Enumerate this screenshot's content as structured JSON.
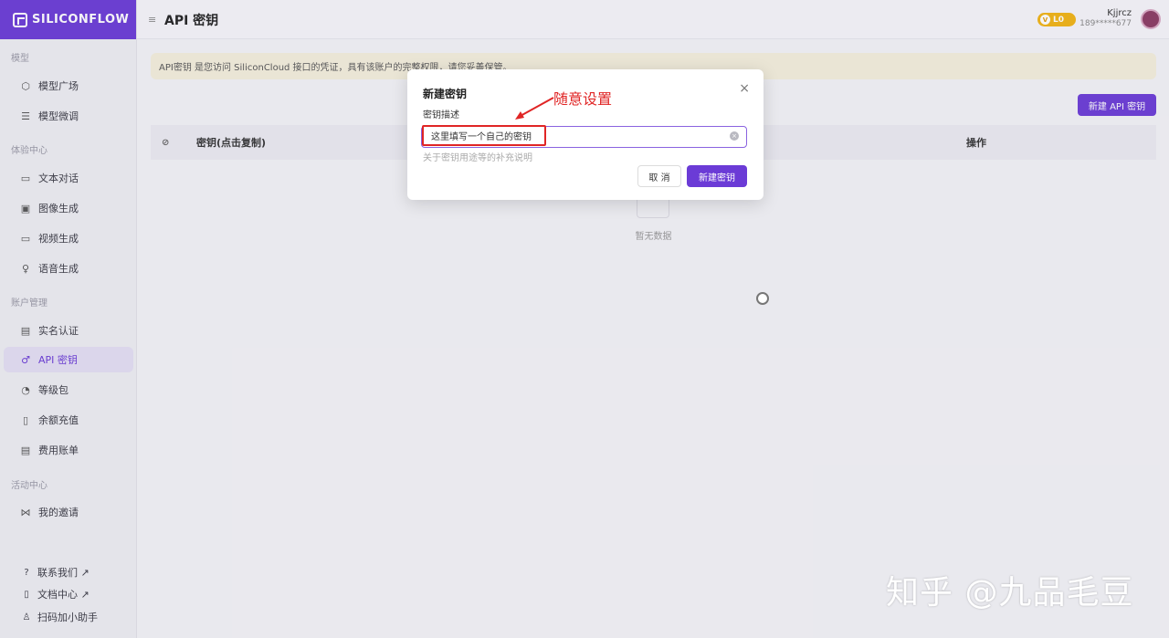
{
  "brand": {
    "logo_text": "SILICONFLOW"
  },
  "header": {
    "menu_icon": "menu-icon",
    "title": "API 密钥",
    "level": "L0",
    "level_coin": "V",
    "user_name": "Kjjrcz",
    "user_phone": "189*****677"
  },
  "sidebar": {
    "sections": [
      {
        "label": "模型"
      },
      {
        "label": "体验中心"
      },
      {
        "label": "账户管理"
      },
      {
        "label": "活动中心"
      }
    ],
    "items": [
      {
        "label": "模型广场",
        "icon": "cube-icon",
        "glyph": "⬡"
      },
      {
        "label": "模型微调",
        "icon": "sliders-icon",
        "glyph": "☰"
      },
      {
        "label": "文本对话",
        "icon": "chat-icon",
        "glyph": "▭"
      },
      {
        "label": "图像生成",
        "icon": "image-icon",
        "glyph": "▣"
      },
      {
        "label": "视频生成",
        "icon": "video-icon",
        "glyph": "▭"
      },
      {
        "label": "语音生成",
        "icon": "mic-icon",
        "glyph": "♀"
      },
      {
        "label": "实名认证",
        "icon": "id-card-icon",
        "glyph": "▤"
      },
      {
        "label": "API 密钥",
        "icon": "key-icon",
        "glyph": "♂"
      },
      {
        "label": "等级包",
        "icon": "gauge-icon",
        "glyph": "◔"
      },
      {
        "label": "余额充值",
        "icon": "recharge-icon",
        "glyph": "▯"
      },
      {
        "label": "费用账单",
        "icon": "bill-icon",
        "glyph": "▤"
      },
      {
        "label": "我的邀请",
        "icon": "share-icon",
        "glyph": "⋈"
      }
    ],
    "footer": [
      {
        "label": "联系我们 ↗",
        "icon": "help-icon",
        "glyph": "?"
      },
      {
        "label": "文档中心 ↗",
        "icon": "doc-icon",
        "glyph": "▯"
      },
      {
        "label": "扫码加小助手",
        "icon": "user-icon",
        "glyph": "♙"
      }
    ]
  },
  "notice": {
    "text": "API密钥 是您访问 SiliconCloud 接口的凭证，具有该账户的完整权限，请您妥善保管。"
  },
  "main": {
    "new_key_button": "新建 API 密钥",
    "table": {
      "columns": {
        "key": "密钥(点击复制)",
        "op": "操作"
      },
      "empty_text": "暂无数据"
    }
  },
  "modal": {
    "title": "新建密钥",
    "close": "×",
    "field_label": "密钥描述",
    "field_value": "这里填写一个自己的密钥",
    "field_hint": "关于密钥用途等的补充说明",
    "cancel": "取 消",
    "submit": "新建密钥"
  },
  "annotation": {
    "text": "随意设置",
    "color": "#e02525"
  },
  "watermark": {
    "text": "知乎 @九品毛豆"
  },
  "colors": {
    "accent": "#6b3bd6",
    "notice_bg": "#f5efdc",
    "level_badge": "#f1b313"
  }
}
